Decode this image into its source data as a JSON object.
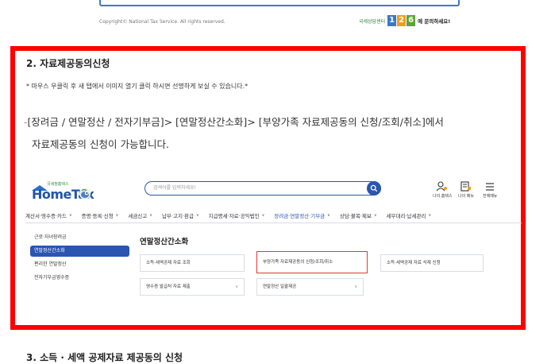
{
  "footer": {
    "copyright": "Copyright© National Tax Service. All rights reserved.",
    "brand_small": "국세상담센터",
    "brand_number": [
      "1",
      "2",
      "6"
    ],
    "brand_ask": "에 문의하세요!"
  },
  "section": {
    "title": "2. 자료제공동의신청",
    "note": "* 마우스 우클릭 후 새 탭에서 이미지 열기 클릭 하시면 선명하게 보실 수 있습니다.*",
    "desc_dash": "-",
    "desc_line1": "[장려금 / 연말정산 / 전자기부금]> [연말정산간소화]> [부양가족 자료제공동의 신청/조회/취소]에서",
    "desc_line2": "자료제공동의 신청이 가능합니다."
  },
  "hometax": {
    "logo_sub": "국세청홈택스",
    "logo_main": "HomeTax",
    "search_placeholder": "검색어를 입력하세요!",
    "header_icons": [
      {
        "icon": "user-key-icon",
        "label": "나의 홈택스"
      },
      {
        "icon": "menu-edit-icon",
        "label": "나의 메뉴"
      },
      {
        "icon": "hamburger-icon",
        "label": "전체메뉴"
      }
    ],
    "nav": [
      {
        "label": "계산서·영수증·카드"
      },
      {
        "label": "증명·등록·신청"
      },
      {
        "label": "세금신고"
      },
      {
        "label": "납부·고지·환급"
      },
      {
        "label": "지급명세·자료·공익법인"
      },
      {
        "label": "장려금·연말정산·기부금",
        "active": true
      },
      {
        "label": "상담·불복·제보"
      },
      {
        "label": "세무대리·납세관리"
      }
    ],
    "sidebar": [
      {
        "label": "근로·자녀장려금"
      },
      {
        "label": "연말정산간소화",
        "active": true
      },
      {
        "label": "편리한 연말정산"
      },
      {
        "label": "전자기부금영수증"
      }
    ],
    "content_title": "연말정산간소화",
    "cards": [
      {
        "label": "소득·세액공제 자료 조회"
      },
      {
        "label": "부양가족 자료제공동의 신청/조회/취소",
        "highlighted": true
      },
      {
        "label": "소득·세액공제 자료 삭제 신청"
      },
      {
        "label": "영수증 발급처 자료 제출"
      },
      {
        "label": "연말정산 일괄제공"
      }
    ]
  },
  "next_section_title": "3. 소득 · 세액 공제자료 제공동의 신청",
  "colors": {
    "frame": "#ff0000",
    "brand_blue": "#2a55b0",
    "highlight_red": "#e53935"
  }
}
